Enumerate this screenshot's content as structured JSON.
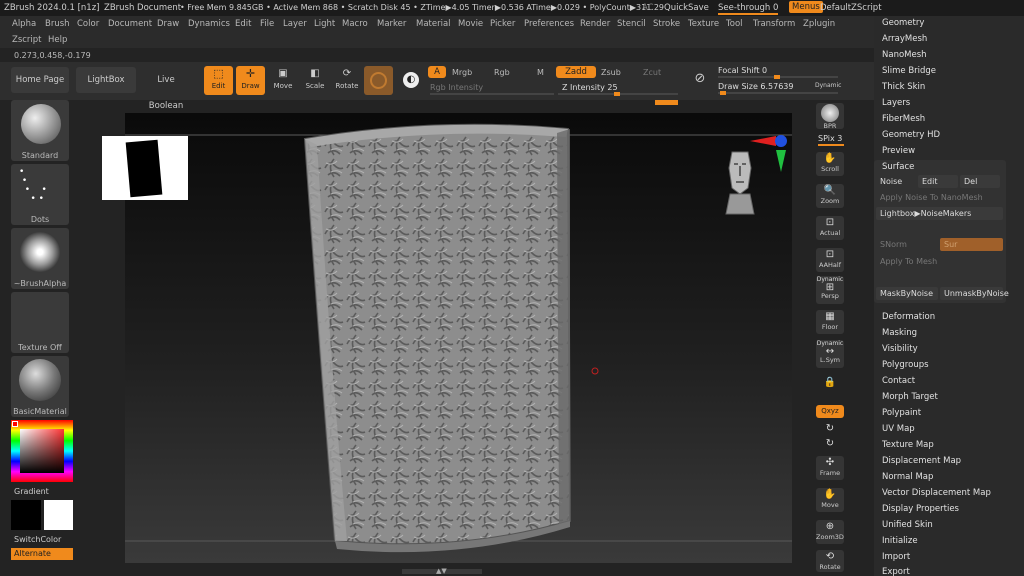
{
  "titlebar": {
    "app": "ZBrush 2024.0.1 [n1z]",
    "document": "ZBrush Document",
    "status": "• Free Mem 9.845GB • Active Mem 868 • Scratch Disk 45 • ZTime▶4.05 Timer▶0.536 ATime▶0.029 • PolyCount▶311.29",
    "ac": "AC",
    "quicksave": "QuickSave",
    "seethrough": "See-through  0",
    "menus": "Menus",
    "script": "DefaultZScript"
  },
  "menus": [
    "Alpha",
    "Brush",
    "Color",
    "Document",
    "Draw",
    "Dynamics",
    "Edit",
    "File",
    "Layer",
    "Light",
    "Macro",
    "Marker",
    "Material",
    "Movie",
    "Picker",
    "Preferences",
    "Render",
    "Stencil",
    "Stroke",
    "Texture",
    "Tool",
    "Transform",
    "Zplugin"
  ],
  "menus2": [
    "Zscript",
    "Help"
  ],
  "coords": "0.273,0.458,-0.179",
  "topbar": {
    "home": "Home Page",
    "lightbox": "LightBox",
    "liveboolean": "Live Boolean",
    "edit": "Edit",
    "draw": "Draw",
    "move": "Move",
    "scale": "Scale",
    "rotate": "Rotate",
    "a": "A",
    "mrgb": "Mrgb",
    "rgb": "Rgb",
    "m": "M",
    "rgb_intensity": "Rgb Intensity",
    "zadd": "Zadd",
    "zsub": "Zsub",
    "zcut": "Zcut",
    "z_intensity": "Z Intensity 25",
    "focal_shift": "Focal Shift 0",
    "draw_size": "Draw Size 6.57639",
    "dynamic": "Dynamic"
  },
  "left": {
    "standard": "Standard",
    "dots": "Dots",
    "brushalpha": "~BrushAlpha",
    "textureoff": "Texture Off",
    "material": "BasicMaterial",
    "gradient": "Gradient",
    "switchcolor": "SwitchColor",
    "alternate": "Alternate"
  },
  "righttools": {
    "bpr": "BPR",
    "spix": "SPix 3",
    "scroll": "Scroll",
    "zoom": "Zoom",
    "actual": "Actual",
    "aahalf": "AAHalf",
    "persp_dynamic": "Dynamic",
    "persp": "Persp",
    "floor": "Floor",
    "lsym_dynamic": "Dynamic",
    "lsym": "L.Sym",
    "xyz": "Qxyz",
    "frame": "Frame",
    "move": "Move",
    "zoom3d": "Zoom3D",
    "rotate": "Rotate"
  },
  "rightpanel": {
    "top_items": [
      "Geometry",
      "ArrayMesh",
      "NanoMesh",
      "Slime Bridge",
      "Thick Skin",
      "Layers",
      "FiberMesh",
      "Geometry HD",
      "Preview",
      "Surface"
    ],
    "surface": {
      "noise": "Noise",
      "edit": "Edit",
      "del": "Del",
      "apply_nanomesh": "Apply Noise To NanoMesh",
      "lightbox_noise": "Lightbox▶NoiseMakers",
      "snorm": "SNorm",
      "sur": "Sur",
      "apply_mesh": "Apply To Mesh",
      "maskbynoise": "MaskByNoise",
      "unmaskbynoise": "UnmaskByNoise"
    },
    "bottom_items": [
      "Deformation",
      "Masking",
      "Visibility",
      "Polygroups",
      "Contact",
      "Morph Target",
      "Polypaint",
      "UV Map",
      "Texture Map",
      "Displacement Map",
      "Normal Map",
      "Vector Displacement Map",
      "Display Properties",
      "Unified Skin",
      "Initialize",
      "Import",
      "Export"
    ]
  },
  "colors": {
    "accent": "#f08a1c",
    "panel": "#2a2a2a",
    "bg": "#232323"
  }
}
